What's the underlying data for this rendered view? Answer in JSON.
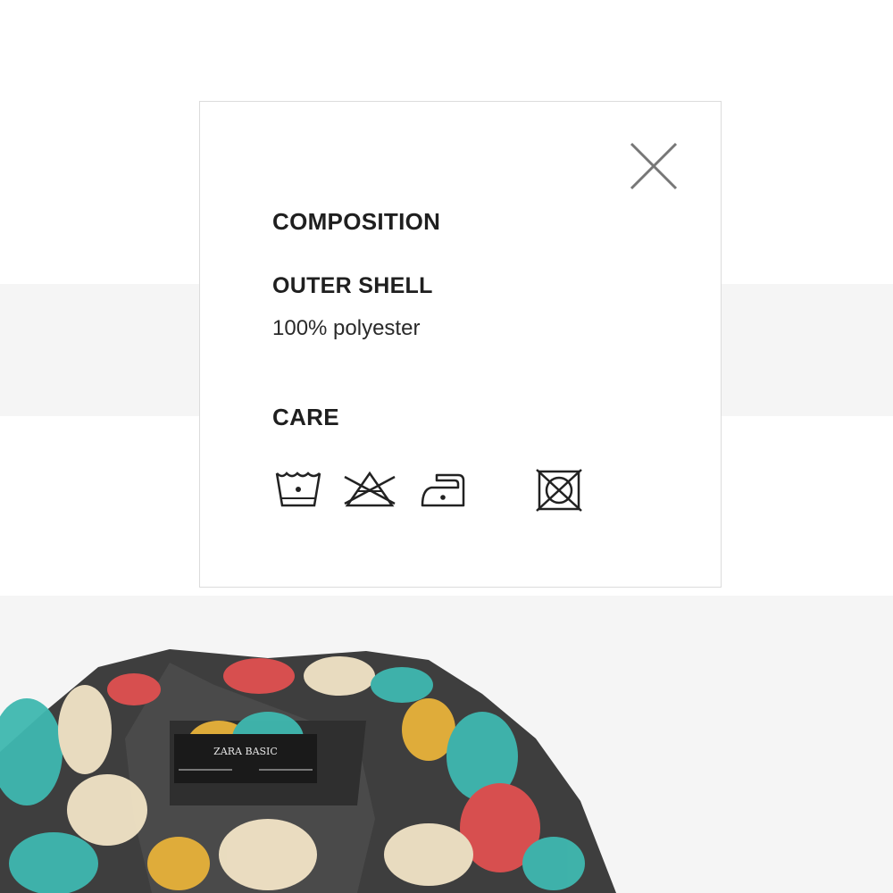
{
  "modal": {
    "close_icon": "close-icon",
    "composition_title": "COMPOSITION",
    "outer_shell_title": "OUTER SHELL",
    "outer_shell_value": "100% polyester",
    "care_title": "CARE",
    "care_icons": [
      "wash-30-icon",
      "do-not-bleach-icon",
      "iron-low-icon",
      "do-not-tumble-dry-icon"
    ]
  },
  "product_image": {
    "label_text": "ZARA BASIC"
  },
  "colors": {
    "text_dark": "#1f1f1f",
    "icon_gray": "#555555",
    "band_gray": "#f5f5f5"
  }
}
